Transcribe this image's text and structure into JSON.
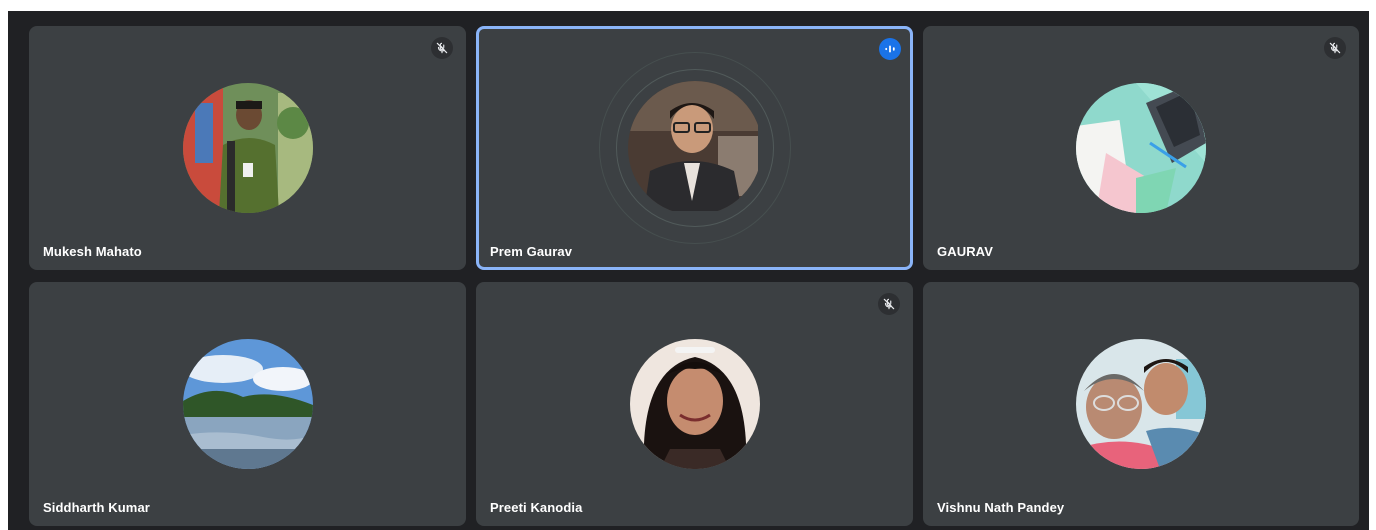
{
  "participants": [
    {
      "name": "Mukesh Mahato",
      "status": "muted",
      "status_icon": "mic-off-icon"
    },
    {
      "name": "Prem Gaurav",
      "status": "speaking",
      "status_icon": "audio-wave-icon"
    },
    {
      "name": "GAURAV",
      "status": "muted",
      "status_icon": "mic-off-icon"
    },
    {
      "name": "Siddharth Kumar",
      "status": "unmuted",
      "status_icon": ""
    },
    {
      "name": "Preeti Kanodia",
      "status": "muted",
      "status_icon": "mic-off-icon"
    },
    {
      "name": "Vishnu Nath Pandey",
      "status": "unmuted",
      "status_icon": ""
    }
  ],
  "colors": {
    "background": "#202124",
    "tile": "#3c4043",
    "speaking_border": "#8ab4f8",
    "speaking_badge": "#1a73e8",
    "text": "#ffffff"
  }
}
